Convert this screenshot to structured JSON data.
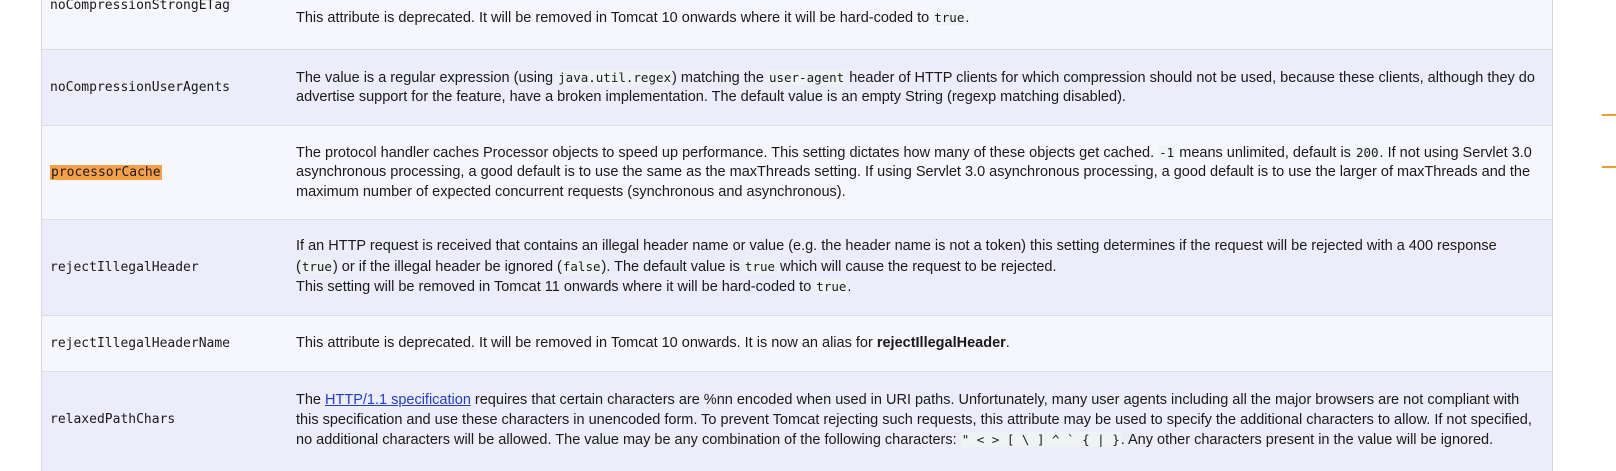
{
  "rows": [
    {
      "name": "noCompressionStrongETag",
      "desc": {
        "t1": "This attribute is deprecated. It will be removed in Tomcat 10 onwards where it will be hard-coded to ",
        "c1": "true",
        "t2": "."
      }
    },
    {
      "name": "noCompressionUserAgents",
      "desc": {
        "t1": "The value is a regular expression (using ",
        "c1": "java.util.regex",
        "t2": ") matching the ",
        "c2": "user-agent",
        "t3": " header of HTTP clients for which compression should not be used, because these clients, although they do advertise support for the feature, have a broken implementation. The default value is an empty String (regexp matching disabled)."
      }
    },
    {
      "name": "processorCache",
      "desc": {
        "t1": "The protocol handler caches Processor objects to speed up performance. This setting dictates how many of these objects get cached. ",
        "c1": "-1",
        "t2": " means unlimited, default is ",
        "c2": "200",
        "t3": ". If not using Servlet 3.0 asynchronous processing, a good default is to use the same as the maxThreads setting. If using Servlet 3.0 asynchronous processing, a good default is to use the larger of maxThreads and the maximum number of expected concurrent requests (synchronous and asynchronous)."
      }
    },
    {
      "name": "rejectIllegalHeader",
      "desc": {
        "t1": "If an HTTP request is received that contains an illegal header name or value (e.g. the header name is not a token) this setting determines if the request will be rejected with a 400 response (",
        "c1": "true",
        "t2": ") or if the illegal header be ignored (",
        "c2": "false",
        "t3": "). The default value is ",
        "c3": "true",
        "t4": " which will cause the request to be rejected.",
        "t5": "This setting will be removed in Tomcat 11 onwards where it will be hard-coded to ",
        "c4": "true",
        "t6": "."
      }
    },
    {
      "name": "rejectIllegalHeaderName",
      "desc": {
        "t1": "This attribute is deprecated. It will be removed in Tomcat 10 onwards. It is now an alias for ",
        "b1": "rejectIllegalHeader",
        "t2": "."
      }
    },
    {
      "name": "relaxedPathChars",
      "desc": {
        "t1": "The ",
        "link": "HTTP/1.1 specification",
        "t2": " requires that certain characters are %nn encoded when used in URI paths. Unfortunately, many user agents including all the major browsers are not compliant with this specification and use these characters in unencoded form. To prevent Tomcat rejecting such requests, this attribute may be used to specify the additional characters to allow. If not specified, no additional characters will be allowed. The value may be any combination of the following characters: ",
        "c1": "\" < > [ \\ ] ^ ` { | }",
        "t3": ". Any other characters present in the value will be ignored."
      }
    }
  ],
  "colors": {
    "highlight": "#f5a049",
    "row_light": "#f6f6fd",
    "row_dark": "#ececfa",
    "link": "#1f3fc8"
  }
}
